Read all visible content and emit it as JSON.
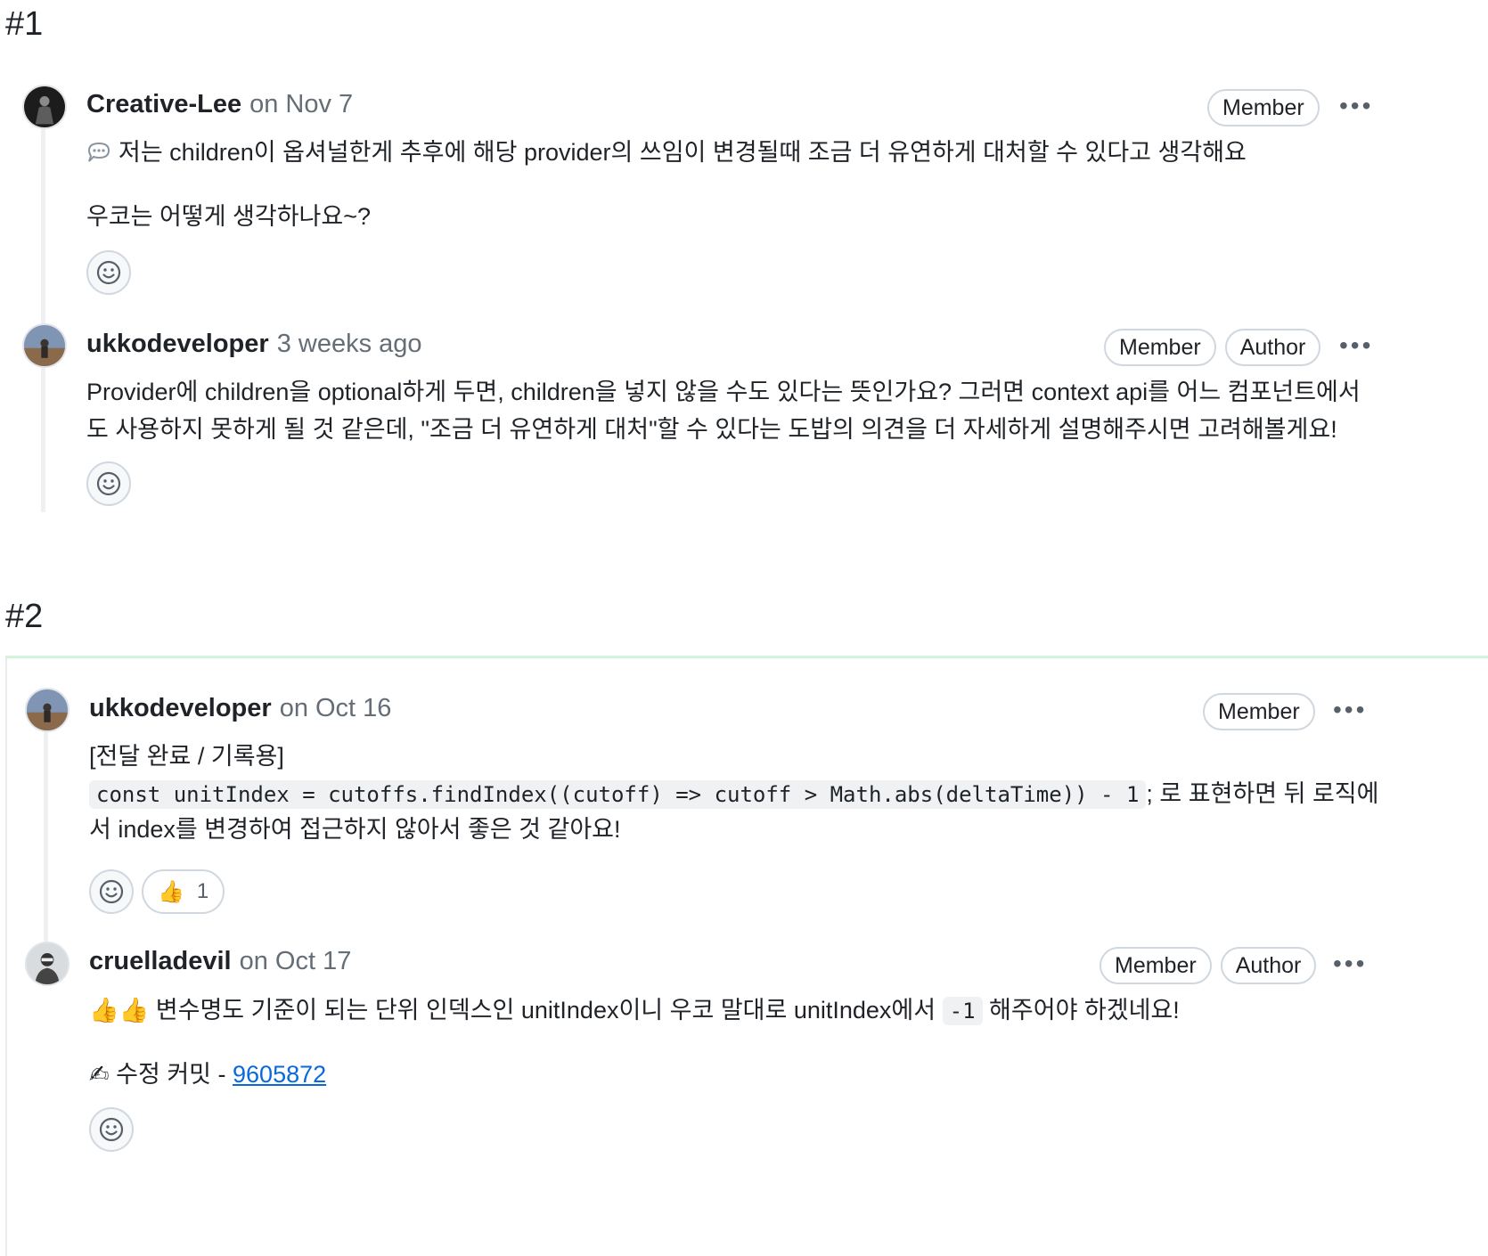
{
  "sections": [
    {
      "label": "#1",
      "comments": [
        {
          "author": "Creative-Lee",
          "date": "on Nov 7",
          "badges": [
            "Member"
          ],
          "paragraphs": [
            "저는 children이 옵셔널한게 추후에 해당 provider의 쓰임이 변경될때 조금 더 유연하게 대처할 수 있다고 생각해요",
            "우코는 어떻게 생각하나요~?"
          ]
        },
        {
          "author": "ukkodeveloper",
          "date": "3 weeks ago",
          "badges": [
            "Member",
            "Author"
          ],
          "paragraphs": [
            "Provider에 children을 optional하게 두면, children을 넣지 않을 수도 있다는 뜻인가요? 그러면 context api를 어느 컴포넌트에서",
            "도 사용하지 못하게 될 것 같은데, \"조금 더 유연하게 대처\"할 수 있다는 도밥의 의견을 더 자세하게 설명해주시면 고려해볼게요!"
          ]
        }
      ]
    },
    {
      "label": "#2",
      "comments": [
        {
          "author": "ukkodeveloper",
          "date": "on Oct 16",
          "badges": [
            "Member"
          ],
          "heading": "[전달 완료 / 기록용]",
          "code": "const unitIndex = cutoffs.findIndex((cutoff) => cutoff > Math.abs(deltaTime)) - 1",
          "after_code": "; 로 표현하면 뒤 로직에",
          "line2": "서 index를 변경하여 접근하지 않아서 좋은 것 같아요!",
          "reaction": {
            "emoji": "👍",
            "count": "1"
          }
        },
        {
          "author": "cruelladevil",
          "date": "on Oct 17",
          "badges": [
            "Member",
            "Author"
          ],
          "line1_emoji": "👍👍",
          "line1_text": "변수명도 기준이 되는 단위 인덱스인 unitIndex이니 우코 말대로 unitIndex에서",
          "line1_code": "-1",
          "line1_after": "해주어야 하겠네요!",
          "line2_emoji": "✍",
          "line2_text": "수정 커밋 -",
          "commit_link": "9605872"
        }
      ]
    }
  ],
  "kebab_glyph": "•••",
  "icons": {
    "speech": "speech-bubble-icon",
    "smiley": "smiley-icon"
  }
}
